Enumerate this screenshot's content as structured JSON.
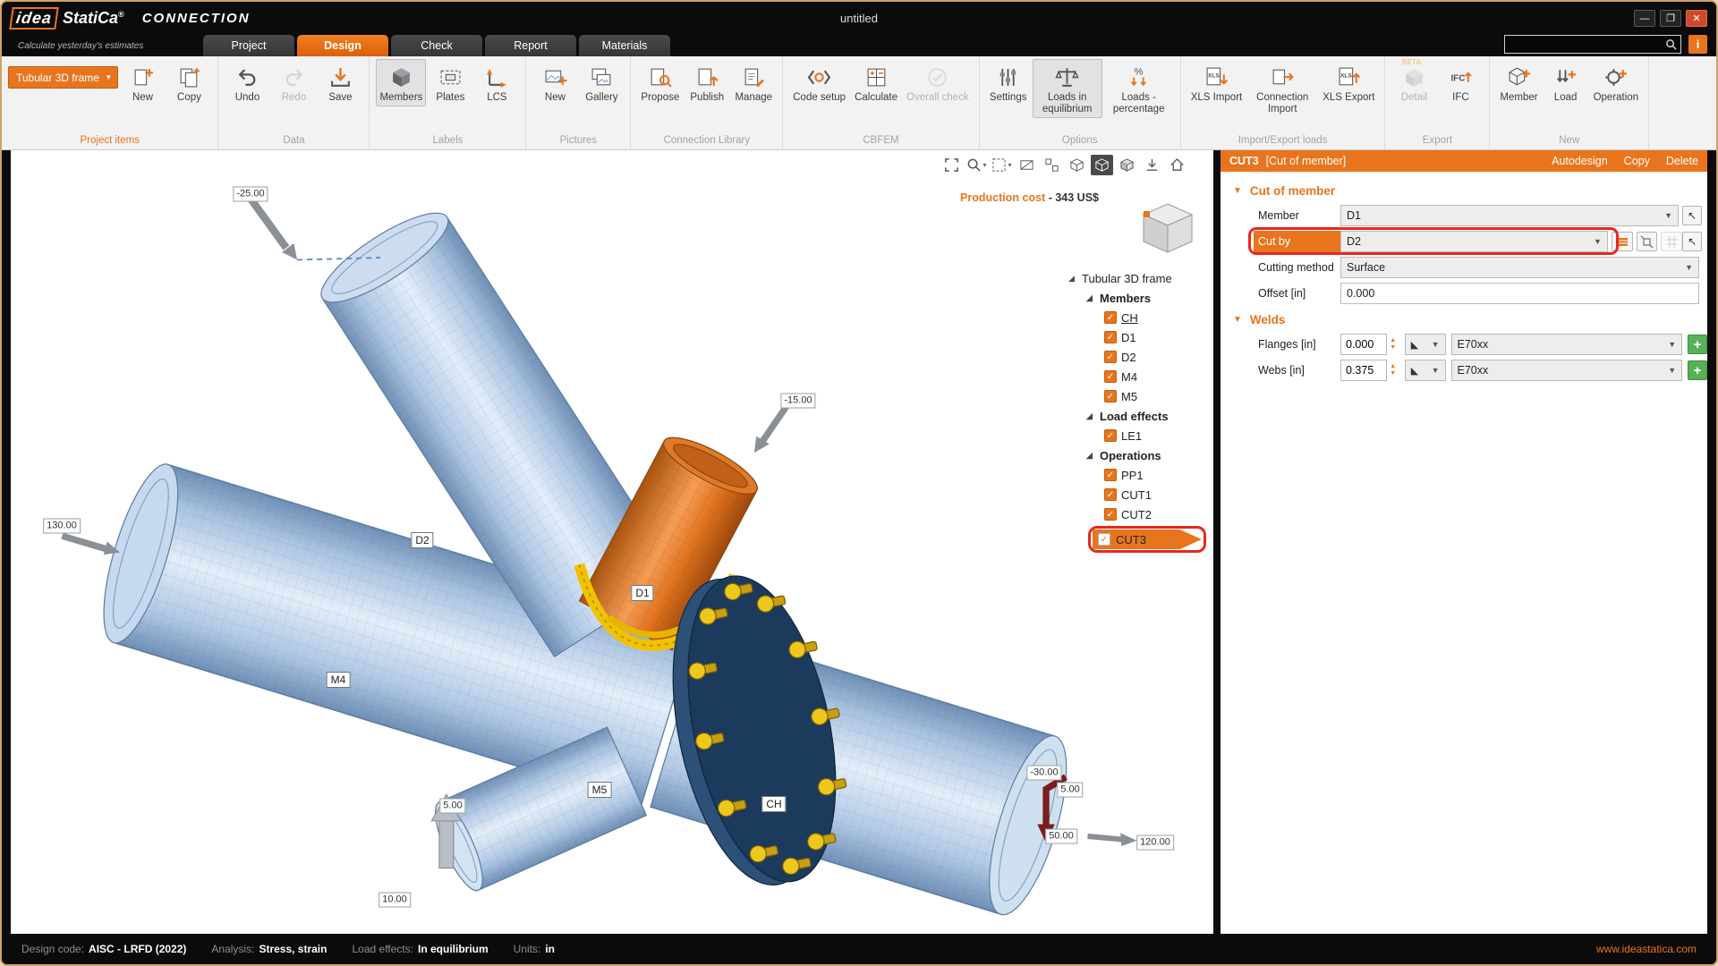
{
  "window": {
    "brand_idea": "idea",
    "brand_statica": "StatiCa",
    "brand_reg": "®",
    "app_name": "CONNECTION",
    "tagline": "Calculate yesterday's estimates",
    "doc_title": "untitled",
    "controls": {
      "minimize": "—",
      "maximize": "❐",
      "close": "✕"
    },
    "info_button": "i"
  },
  "tabs": [
    {
      "label": "Project"
    },
    {
      "label": "Design"
    },
    {
      "label": "Check"
    },
    {
      "label": "Report"
    },
    {
      "label": "Materials"
    }
  ],
  "ribbon": {
    "groups": [
      {
        "label": "Project items",
        "dropdown": "Tubular 3D frame",
        "buttons": [
          {
            "label": "New"
          },
          {
            "label": "Copy"
          }
        ]
      },
      {
        "label": "Data",
        "buttons": [
          {
            "label": "Undo"
          },
          {
            "label": "Redo"
          },
          {
            "label": "Save"
          }
        ]
      },
      {
        "label": "Labels",
        "buttons": [
          {
            "label": "Members"
          },
          {
            "label": "Plates"
          },
          {
            "label": "LCS"
          }
        ]
      },
      {
        "label": "Pictures",
        "buttons": [
          {
            "label": "New"
          },
          {
            "label": "Gallery"
          }
        ]
      },
      {
        "label": "Connection Library",
        "buttons": [
          {
            "label": "Propose"
          },
          {
            "label": "Publish"
          },
          {
            "label": "Manage"
          }
        ]
      },
      {
        "label": "CBFEM",
        "buttons": [
          {
            "label": "Code setup"
          },
          {
            "label": "Calculate"
          },
          {
            "label": "Overall check"
          }
        ]
      },
      {
        "label": "Options",
        "buttons": [
          {
            "label": "Settings"
          },
          {
            "label": "Loads in equilibrium"
          },
          {
            "label": "Loads - percentage"
          }
        ]
      },
      {
        "label": "Import/Export loads",
        "buttons": [
          {
            "label": "XLS Import"
          },
          {
            "label": "Connection Import"
          },
          {
            "label": "XLS Export"
          }
        ]
      },
      {
        "label": "Export",
        "beta_tag": "BETA",
        "buttons": [
          {
            "label": "Detail"
          },
          {
            "label": "IFC"
          }
        ]
      },
      {
        "label": "New",
        "buttons": [
          {
            "label": "Member"
          },
          {
            "label": "Load"
          },
          {
            "label": "Operation"
          }
        ]
      }
    ]
  },
  "viewport": {
    "production_cost_label": "Production cost",
    "production_cost_sep": "-",
    "production_cost_value": "343 US$",
    "members": {
      "d2": "D2",
      "d1": "D1",
      "m4": "M4",
      "m5": "M5",
      "ch": "CH"
    },
    "dims": {
      "top": "-25.00",
      "left": "130.00",
      "d1": "-15.00",
      "m5cap": "5.00",
      "m5base": "10.00",
      "ch1": "-30.00",
      "ch2": "5.00",
      "ch3": "50.00",
      "ch4": "120.00"
    }
  },
  "tree": {
    "root": "Tubular 3D frame",
    "members_group": "Members",
    "members": [
      {
        "label": "CH"
      },
      {
        "label": "D1"
      },
      {
        "label": "D2"
      },
      {
        "label": "M4"
      },
      {
        "label": "M5"
      }
    ],
    "loads_group": "Load effects",
    "loads": [
      {
        "label": "LE1"
      }
    ],
    "ops_group": "Operations",
    "ops": [
      {
        "label": "PP1"
      },
      {
        "label": "CUT1"
      },
      {
        "label": "CUT2"
      },
      {
        "label": "CUT3"
      }
    ]
  },
  "props": {
    "title": "CUT3",
    "subtitle": "[Cut of member]",
    "actions": {
      "autodesign": "Autodesign",
      "copy": "Copy",
      "delete": "Delete"
    },
    "cut_section": {
      "title": "Cut of member",
      "member_label": "Member",
      "member_value": "D1",
      "cutby_label": "Cut by",
      "cutby_value": "D2",
      "method_label": "Cutting method",
      "method_value": "Surface",
      "offset_label": "Offset [in]",
      "offset_value": "0.000"
    },
    "welds_section": {
      "title": "Welds",
      "flanges_label": "Flanges [in]",
      "flanges_value": "0.000",
      "flanges_material": "E70xx",
      "webs_label": "Webs [in]",
      "webs_value": "0.375",
      "webs_material": "E70xx"
    }
  },
  "statusbar": {
    "design_code_label": "Design code:",
    "design_code": "AISC - LRFD (2022)",
    "analysis_label": "Analysis:",
    "analysis": "Stress, strain",
    "loads_label": "Load effects:",
    "loads": "In equilibrium",
    "units_label": "Units:",
    "units": "in",
    "website": "www.ideastatica.com"
  }
}
